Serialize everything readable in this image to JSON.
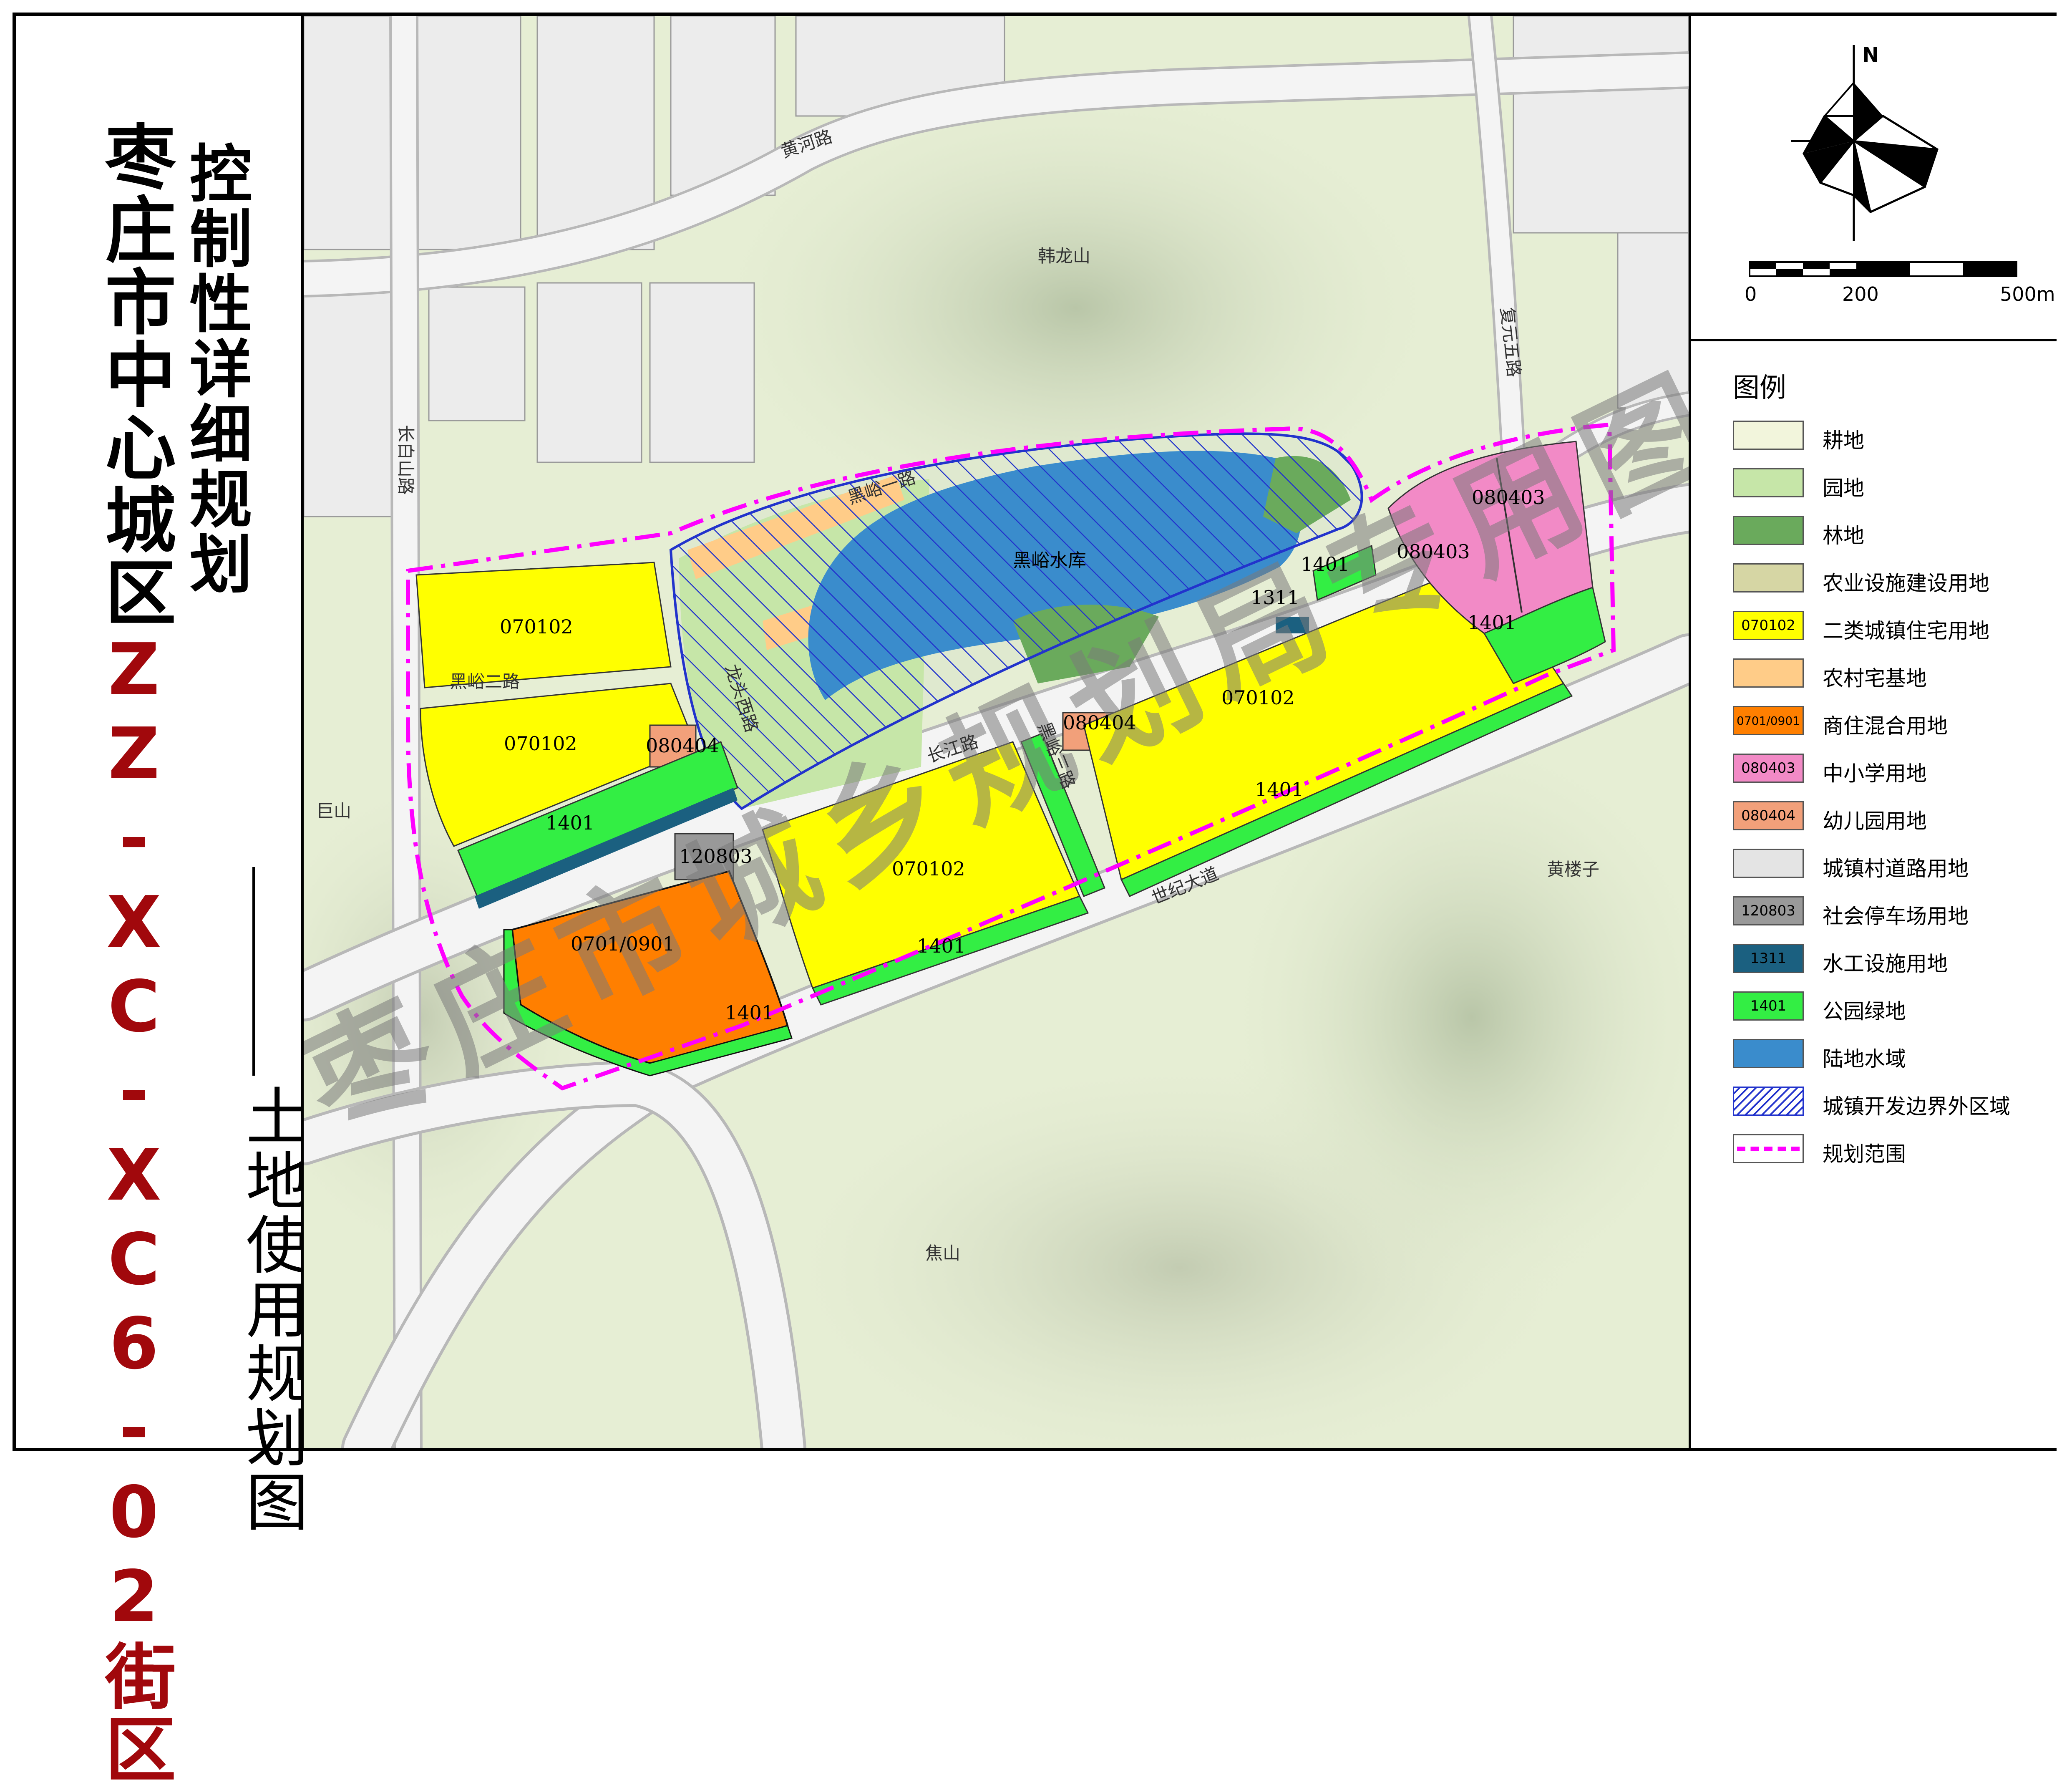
{
  "title": {
    "line1": "控制性详细规划",
    "line2_prefix": "枣庄市中心城区",
    "line2_code": "ZZ-XC-XC6-02街区",
    "subtitle": "土地使用规划图"
  },
  "watermark": "枣庄市城乡规划局专用图",
  "compass": {
    "north_label": "N"
  },
  "scale_bar": {
    "labels": [
      "0",
      "200",
      "500m"
    ]
  },
  "legend": {
    "title": "图例",
    "items": [
      {
        "code": "",
        "label": "耕地",
        "color": "#f2f5dc",
        "pattern": "solid"
      },
      {
        "code": "",
        "label": "园地",
        "color": "#c6e6a8",
        "pattern": "solid"
      },
      {
        "code": "",
        "label": "林地",
        "color": "#6aaa5c",
        "pattern": "solid"
      },
      {
        "code": "",
        "label": "农业设施建设用地",
        "color": "#d6d6a4",
        "pattern": "solid"
      },
      {
        "code": "070102",
        "label": "二类城镇住宅用地",
        "color": "#ffff00",
        "pattern": "solid"
      },
      {
        "code": "",
        "label": "农村宅基地",
        "color": "#ffcc88",
        "pattern": "solid"
      },
      {
        "code": "0701/0901",
        "label": "商住混合用地",
        "color": "#ff7f00",
        "pattern": "solid"
      },
      {
        "code": "080403",
        "label": "中小学用地",
        "color": "#f28ac6",
        "pattern": "solid"
      },
      {
        "code": "080404",
        "label": "幼儿园用地",
        "color": "#f2a07a",
        "pattern": "solid"
      },
      {
        "code": "",
        "label": "城镇村道路用地",
        "color": "#e4e4e4",
        "pattern": "solid"
      },
      {
        "code": "120803",
        "label": "社会停车场用地",
        "color": "#999999",
        "pattern": "solid"
      },
      {
        "code": "1311",
        "label": "水工设施用地",
        "color": "#1b6080",
        "pattern": "solid"
      },
      {
        "code": "1401",
        "label": "公园绿地",
        "color": "#33ee44",
        "pattern": "solid"
      },
      {
        "code": "",
        "label": "陆地水域",
        "color": "#3a8ccc",
        "pattern": "solid"
      },
      {
        "code": "",
        "label": "城镇开发边界外区域",
        "color": "#2233cc",
        "pattern": "hatch"
      },
      {
        "code": "",
        "label": "规划范围",
        "color": "#ff00ff",
        "pattern": "dashline"
      }
    ]
  },
  "map": {
    "place_names": [
      "韩龙山",
      "巨山",
      "黄楼子",
      "焦山"
    ],
    "water_name": "黑峪水库",
    "roads": [
      "黄河路",
      "长白山路",
      "黑峪二路",
      "黑峪一路",
      "复元五路",
      "长江路",
      "黑峪三路",
      "世纪大道",
      "龙头西路"
    ],
    "parcels": [
      {
        "code": "070102",
        "use": "二类城镇住宅用地"
      },
      {
        "code": "070102",
        "use": "二类城镇住宅用地"
      },
      {
        "code": "080404",
        "use": "幼儿园用地"
      },
      {
        "code": "1401",
        "use": "公园绿地"
      },
      {
        "code": "120803",
        "use": "社会停车场用地"
      },
      {
        "code": "0701/0901",
        "use": "商住混合用地"
      },
      {
        "code": "1401",
        "use": "公园绿地"
      },
      {
        "code": "070102",
        "use": "二类城镇住宅用地"
      },
      {
        "code": "1401",
        "use": "公园绿地"
      },
      {
        "code": "080404",
        "use": "幼儿园用地"
      },
      {
        "code": "070102",
        "use": "二类城镇住宅用地"
      },
      {
        "code": "1401",
        "use": "公园绿地"
      },
      {
        "code": "1401",
        "use": "公园绿地"
      },
      {
        "code": "1311",
        "use": "水工设施用地"
      },
      {
        "code": "080403",
        "use": "中小学用地"
      },
      {
        "code": "080403",
        "use": "中小学用地"
      },
      {
        "code": "1401",
        "use": "公园绿地"
      }
    ]
  }
}
